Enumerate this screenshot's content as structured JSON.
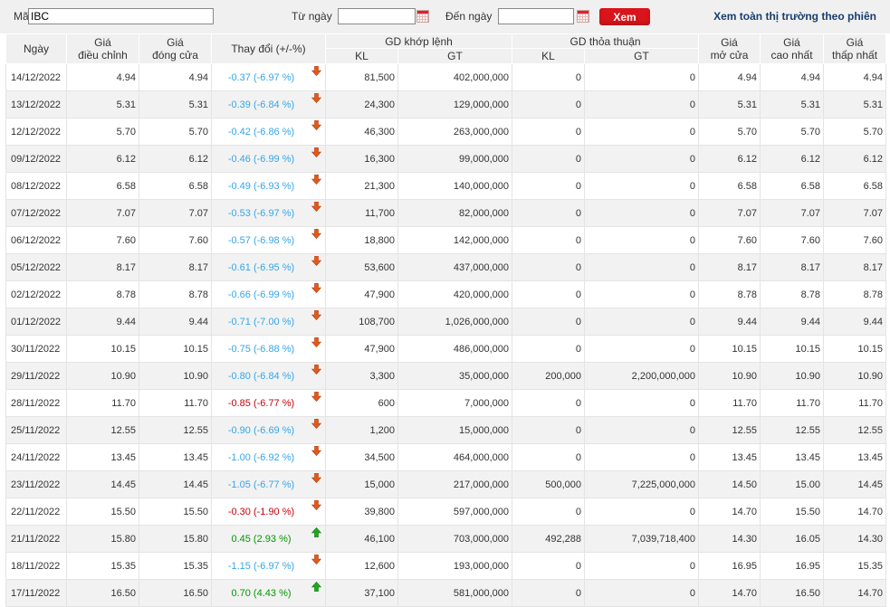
{
  "filter": {
    "symbol_label": "Mã",
    "symbol_value": "IBC",
    "from_label": "Từ ngày",
    "from_value": "",
    "to_label": "Đến ngày",
    "to_value": "",
    "submit_label": "Xem",
    "all_market_link": "Xem toàn thị trường theo phiên"
  },
  "table": {
    "headers": {
      "date": "Ngày",
      "adj_price": [
        "Giá",
        "điều chỉnh"
      ],
      "close_price": [
        "Giá",
        "đóng cửa"
      ],
      "change": "Thay đổi (+/-%)",
      "matched": "GD khớp lệnh",
      "negotiated": "GD thỏa thuận",
      "kl": "KL",
      "gt": "GT",
      "open": [
        "Giá",
        "mở cửa"
      ],
      "high": [
        "Giá",
        "cao nhất"
      ],
      "low": [
        "Giá",
        "thấp nhất"
      ]
    },
    "rows": [
      {
        "date": "14/12/2022",
        "adj": "4.94",
        "close": "4.94",
        "change": "-0.37 (-6.97 %)",
        "change_color": "blue",
        "arrow": "down",
        "m_kl": "81,500",
        "m_gt": "402,000,000",
        "n_kl": "0",
        "n_gt": "0",
        "open": "4.94",
        "high": "4.94",
        "low": "4.94"
      },
      {
        "date": "13/12/2022",
        "adj": "5.31",
        "close": "5.31",
        "change": "-0.39 (-6.84 %)",
        "change_color": "blue",
        "arrow": "down",
        "m_kl": "24,300",
        "m_gt": "129,000,000",
        "n_kl": "0",
        "n_gt": "0",
        "open": "5.31",
        "high": "5.31",
        "low": "5.31"
      },
      {
        "date": "12/12/2022",
        "adj": "5.70",
        "close": "5.70",
        "change": "-0.42 (-6.86 %)",
        "change_color": "blue",
        "arrow": "down",
        "m_kl": "46,300",
        "m_gt": "263,000,000",
        "n_kl": "0",
        "n_gt": "0",
        "open": "5.70",
        "high": "5.70",
        "low": "5.70"
      },
      {
        "date": "09/12/2022",
        "adj": "6.12",
        "close": "6.12",
        "change": "-0.46 (-6.99 %)",
        "change_color": "blue",
        "arrow": "down",
        "m_kl": "16,300",
        "m_gt": "99,000,000",
        "n_kl": "0",
        "n_gt": "0",
        "open": "6.12",
        "high": "6.12",
        "low": "6.12"
      },
      {
        "date": "08/12/2022",
        "adj": "6.58",
        "close": "6.58",
        "change": "-0.49 (-6.93 %)",
        "change_color": "blue",
        "arrow": "down",
        "m_kl": "21,300",
        "m_gt": "140,000,000",
        "n_kl": "0",
        "n_gt": "0",
        "open": "6.58",
        "high": "6.58",
        "low": "6.58"
      },
      {
        "date": "07/12/2022",
        "adj": "7.07",
        "close": "7.07",
        "change": "-0.53 (-6.97 %)",
        "change_color": "blue",
        "arrow": "down",
        "m_kl": "11,700",
        "m_gt": "82,000,000",
        "n_kl": "0",
        "n_gt": "0",
        "open": "7.07",
        "high": "7.07",
        "low": "7.07"
      },
      {
        "date": "06/12/2022",
        "adj": "7.60",
        "close": "7.60",
        "change": "-0.57 (-6.98 %)",
        "change_color": "blue",
        "arrow": "down",
        "m_kl": "18,800",
        "m_gt": "142,000,000",
        "n_kl": "0",
        "n_gt": "0",
        "open": "7.60",
        "high": "7.60",
        "low": "7.60"
      },
      {
        "date": "05/12/2022",
        "adj": "8.17",
        "close": "8.17",
        "change": "-0.61 (-6.95 %)",
        "change_color": "blue",
        "arrow": "down",
        "m_kl": "53,600",
        "m_gt": "437,000,000",
        "n_kl": "0",
        "n_gt": "0",
        "open": "8.17",
        "high": "8.17",
        "low": "8.17"
      },
      {
        "date": "02/12/2022",
        "adj": "8.78",
        "close": "8.78",
        "change": "-0.66 (-6.99 %)",
        "change_color": "blue",
        "arrow": "down",
        "m_kl": "47,900",
        "m_gt": "420,000,000",
        "n_kl": "0",
        "n_gt": "0",
        "open": "8.78",
        "high": "8.78",
        "low": "8.78"
      },
      {
        "date": "01/12/2022",
        "adj": "9.44",
        "close": "9.44",
        "change": "-0.71 (-7.00 %)",
        "change_color": "blue",
        "arrow": "down",
        "m_kl": "108,700",
        "m_gt": "1,026,000,000",
        "n_kl": "0",
        "n_gt": "0",
        "open": "9.44",
        "high": "9.44",
        "low": "9.44"
      },
      {
        "date": "30/11/2022",
        "adj": "10.15",
        "close": "10.15",
        "change": "-0.75 (-6.88 %)",
        "change_color": "blue",
        "arrow": "down",
        "m_kl": "47,900",
        "m_gt": "486,000,000",
        "n_kl": "0",
        "n_gt": "0",
        "open": "10.15",
        "high": "10.15",
        "low": "10.15"
      },
      {
        "date": "29/11/2022",
        "adj": "10.90",
        "close": "10.90",
        "change": "-0.80 (-6.84 %)",
        "change_color": "blue",
        "arrow": "down",
        "m_kl": "3,300",
        "m_gt": "35,000,000",
        "n_kl": "200,000",
        "n_gt": "2,200,000,000",
        "open": "10.90",
        "high": "10.90",
        "low": "10.90"
      },
      {
        "date": "28/11/2022",
        "adj": "11.70",
        "close": "11.70",
        "change": "-0.85 (-6.77 %)",
        "change_color": "red",
        "arrow": "down",
        "m_kl": "600",
        "m_gt": "7,000,000",
        "n_kl": "0",
        "n_gt": "0",
        "open": "11.70",
        "high": "11.70",
        "low": "11.70"
      },
      {
        "date": "25/11/2022",
        "adj": "12.55",
        "close": "12.55",
        "change": "-0.90 (-6.69 %)",
        "change_color": "blue",
        "arrow": "down",
        "m_kl": "1,200",
        "m_gt": "15,000,000",
        "n_kl": "0",
        "n_gt": "0",
        "open": "12.55",
        "high": "12.55",
        "low": "12.55"
      },
      {
        "date": "24/11/2022",
        "adj": "13.45",
        "close": "13.45",
        "change": "-1.00 (-6.92 %)",
        "change_color": "blue",
        "arrow": "down",
        "m_kl": "34,500",
        "m_gt": "464,000,000",
        "n_kl": "0",
        "n_gt": "0",
        "open": "13.45",
        "high": "13.45",
        "low": "13.45"
      },
      {
        "date": "23/11/2022",
        "adj": "14.45",
        "close": "14.45",
        "change": "-1.05 (-6.77 %)",
        "change_color": "blue",
        "arrow": "down",
        "m_kl": "15,000",
        "m_gt": "217,000,000",
        "n_kl": "500,000",
        "n_gt": "7,225,000,000",
        "open": "14.50",
        "high": "15.00",
        "low": "14.45"
      },
      {
        "date": "22/11/2022",
        "adj": "15.50",
        "close": "15.50",
        "change": "-0.30 (-1.90 %)",
        "change_color": "red",
        "arrow": "down",
        "m_kl": "39,800",
        "m_gt": "597,000,000",
        "n_kl": "0",
        "n_gt": "0",
        "open": "14.70",
        "high": "15.50",
        "low": "14.70"
      },
      {
        "date": "21/11/2022",
        "adj": "15.80",
        "close": "15.80",
        "change": "0.45 (2.93 %)",
        "change_color": "green",
        "arrow": "up",
        "m_kl": "46,100",
        "m_gt": "703,000,000",
        "n_kl": "492,288",
        "n_gt": "7,039,718,400",
        "open": "14.30",
        "high": "16.05",
        "low": "14.30"
      },
      {
        "date": "18/11/2022",
        "adj": "15.35",
        "close": "15.35",
        "change": "-1.15 (-6.97 %)",
        "change_color": "blue",
        "arrow": "down",
        "m_kl": "12,600",
        "m_gt": "193,000,000",
        "n_kl": "0",
        "n_gt": "0",
        "open": "16.95",
        "high": "16.95",
        "low": "15.35"
      },
      {
        "date": "17/11/2022",
        "adj": "16.50",
        "close": "16.50",
        "change": "0.70 (4.43 %)",
        "change_color": "green",
        "arrow": "up",
        "m_kl": "37,100",
        "m_gt": "581,000,000",
        "n_kl": "0",
        "n_gt": "0",
        "open": "14.70",
        "high": "16.50",
        "low": "14.70"
      }
    ]
  }
}
